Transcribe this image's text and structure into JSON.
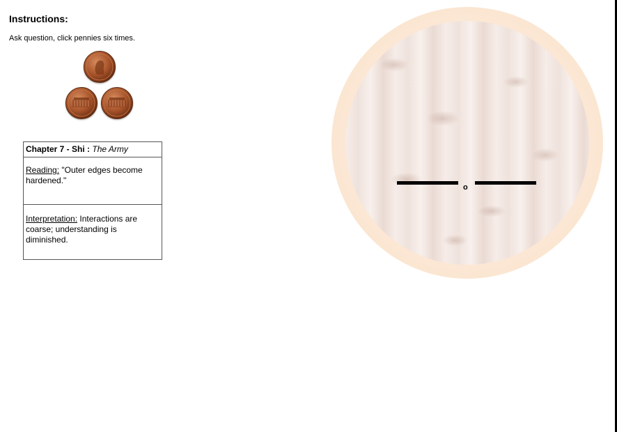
{
  "instructions": {
    "heading": "Instructions:",
    "text": "Ask question, click pennies six times."
  },
  "coins": [
    {
      "name": "penny",
      "face": "heads"
    },
    {
      "name": "penny",
      "face": "tails"
    },
    {
      "name": "penny",
      "face": "tails"
    }
  ],
  "reading_card": {
    "chapter_label": "Chapter 7 - Shi :",
    "chapter_title": "The Army",
    "reading_label": "Reading:",
    "reading_text": "\"Outer edges become hardened.\"",
    "interpretation_label": "Interpretation:",
    "interpretation_text": "Interactions are coarse; understanding is diminished."
  },
  "hexagram": {
    "line_marker": "o",
    "line_type": "broken (changing yin)"
  },
  "colors": {
    "copper": "#9a4a24",
    "oracle_ring": "#fbe4cf",
    "oracle_marble": "#f3e8e3"
  }
}
